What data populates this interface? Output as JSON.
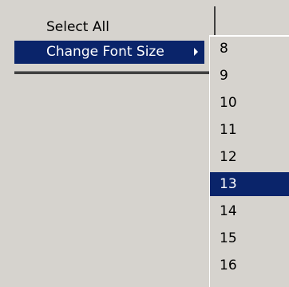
{
  "context_menu": {
    "items": [
      {
        "label": "Select All"
      },
      {
        "label": "Change Font Size",
        "has_submenu": true
      }
    ]
  },
  "font_size_submenu": {
    "options": [
      "8",
      "9",
      "10",
      "11",
      "12",
      "13",
      "14",
      "15",
      "16"
    ],
    "selected": "13"
  },
  "colors": {
    "menu_bg": "#d6d3ce",
    "highlight_bg": "#0a246a",
    "highlight_text": "#ffffff"
  }
}
